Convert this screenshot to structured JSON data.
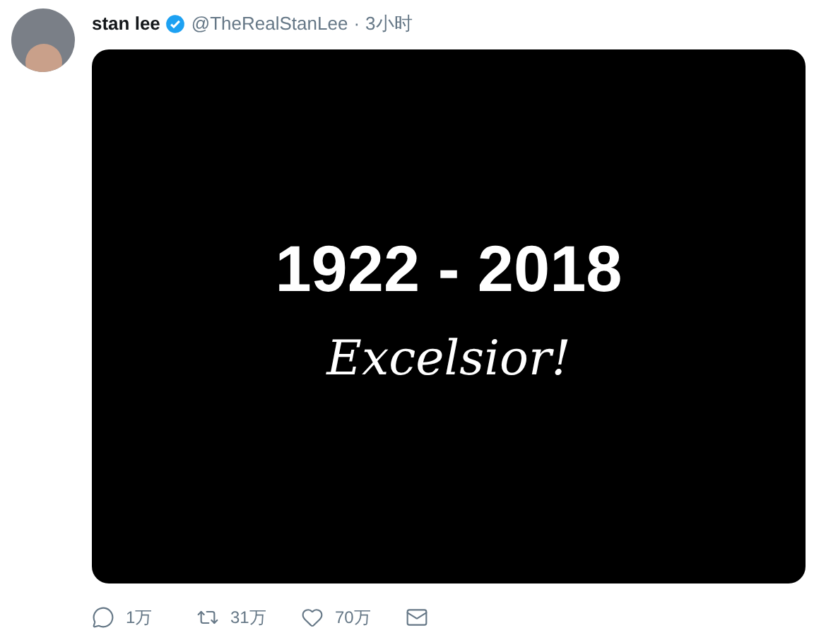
{
  "tweet": {
    "name": "stan lee",
    "verified": true,
    "handle": "@TheRealStanLee",
    "separator": "·",
    "time": "3小时",
    "media": {
      "headline": "1922 - 2018",
      "tagline": "Excelsior!"
    },
    "actions": [
      {
        "kind": "reply",
        "count": "1万"
      },
      {
        "kind": "retweet",
        "count": "31万"
      },
      {
        "kind": "like",
        "count": "70万"
      },
      {
        "kind": "message"
      }
    ]
  }
}
